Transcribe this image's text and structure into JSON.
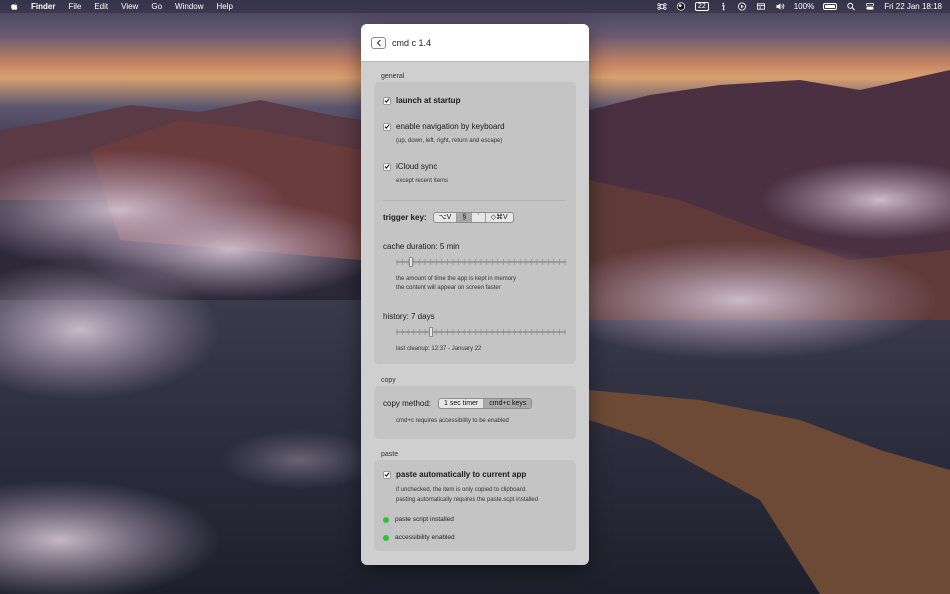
{
  "menubar": {
    "app": "Finder",
    "items": [
      "File",
      "Edit",
      "View",
      "Go",
      "Window",
      "Help"
    ],
    "calendar_badge": "22",
    "battery": "100%",
    "datetime": "Fri 22 Jan  18:18"
  },
  "window": {
    "title": "cmd c 1.4",
    "general": {
      "section": "general",
      "launch_at_startup": {
        "label": "launch at startup",
        "checked": true
      },
      "keyboard_nav": {
        "label": "enable navigation by keyboard",
        "checked": true,
        "note": "(up, down, left, right, return and escape)"
      },
      "icloud": {
        "label": "iCloud sync",
        "checked": true,
        "note": "except recent items"
      },
      "trigger": {
        "label": "trigger key:",
        "options": [
          "⌥V",
          "§",
          "`",
          "◇⌘V"
        ],
        "selected_index": 1
      },
      "cache": {
        "label": "cache duration: 5 min",
        "level": 0.08,
        "note1": "the amount of time the app is kept in memory",
        "note2": "the content will appear on screen faster"
      },
      "history": {
        "label": "history: 7 days",
        "level": 0.2,
        "note": "last cleanup: 12:37 - January 22"
      }
    },
    "copy": {
      "section": "copy",
      "label": "copy method:",
      "options": [
        "1 sec timer",
        "cmd+c keys"
      ],
      "selected_index": 1,
      "note": "cmd+c requires accessibility to be enabled"
    },
    "paste": {
      "section": "paste",
      "auto_paste": {
        "label": "paste automatically to current app",
        "checked": true
      },
      "note1": "if unchecked, the item is only copied to clipboard.",
      "note2": "pasting automatically requires the paste.scpt installed",
      "status1": "paste script installed",
      "status2": "accessibility enabled",
      "status_color": "#2fbf3d"
    }
  }
}
